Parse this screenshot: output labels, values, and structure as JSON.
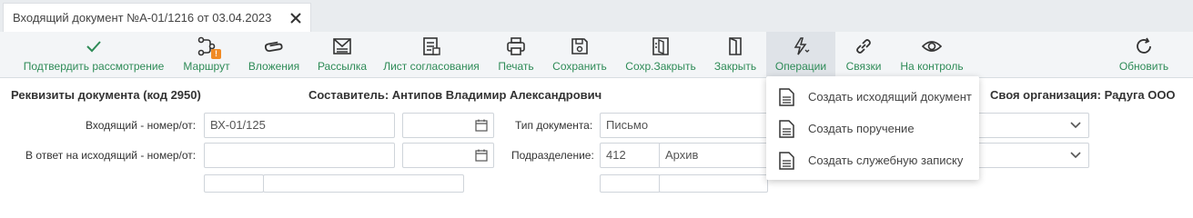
{
  "tab": {
    "title": "Входящий документ №А-01/1216 от 03.04.2023"
  },
  "toolbar": {
    "buttons": [
      {
        "label": "Подтвердить рассмотрение",
        "icon": "check-icon"
      },
      {
        "label": "Маршрут",
        "icon": "route-icon",
        "badge": "!"
      },
      {
        "label": "Вложения",
        "icon": "paperclip-icon"
      },
      {
        "label": "Рассылка",
        "icon": "mailing-icon"
      },
      {
        "label": "Лист согласования",
        "icon": "approval-sheet-icon"
      },
      {
        "label": "Печать",
        "icon": "printer-icon"
      },
      {
        "label": "Сохранить",
        "icon": "save-icon"
      },
      {
        "label": "Сохр.Закрыть",
        "icon": "save-close-icon"
      },
      {
        "label": "Закрыть",
        "icon": "door-icon"
      },
      {
        "label": "Операции",
        "icon": "lightning-icon"
      },
      {
        "label": "Связки",
        "icon": "link-icon"
      },
      {
        "label": "На контроль",
        "icon": "eye-icon"
      },
      {
        "label": "Обновить",
        "icon": "refresh-icon"
      }
    ]
  },
  "form": {
    "requisites_title": "Реквизиты документа (код 2950)",
    "author_title": "Составитель: Антипов Владимир Александрович",
    "org_title": "Своя организация: Радуга ООО",
    "incoming_label": "Входящий - номер/от:",
    "incoming_number": "ВХ-01/125",
    "incoming_date": "",
    "reply_label": "В ответ на исходящий - номер/от:",
    "reply_number": "",
    "reply_date": "",
    "doc_type_label": "Тип документа:",
    "doc_type_value": "Письмо",
    "department_label": "Подразделение:",
    "department_code": "412",
    "department_name": "Архив"
  },
  "operations_menu": {
    "items": [
      {
        "label": "Создать исходящий документ",
        "icon": "document-icon"
      },
      {
        "label": "Создать поручение",
        "icon": "document-icon"
      },
      {
        "label": "Создать служебную записку",
        "icon": "document-icon"
      }
    ]
  },
  "colors": {
    "accent_green": "#2e8b57",
    "badge_orange": "#f08a24",
    "toolbar_bg": "#f3f5f7"
  }
}
